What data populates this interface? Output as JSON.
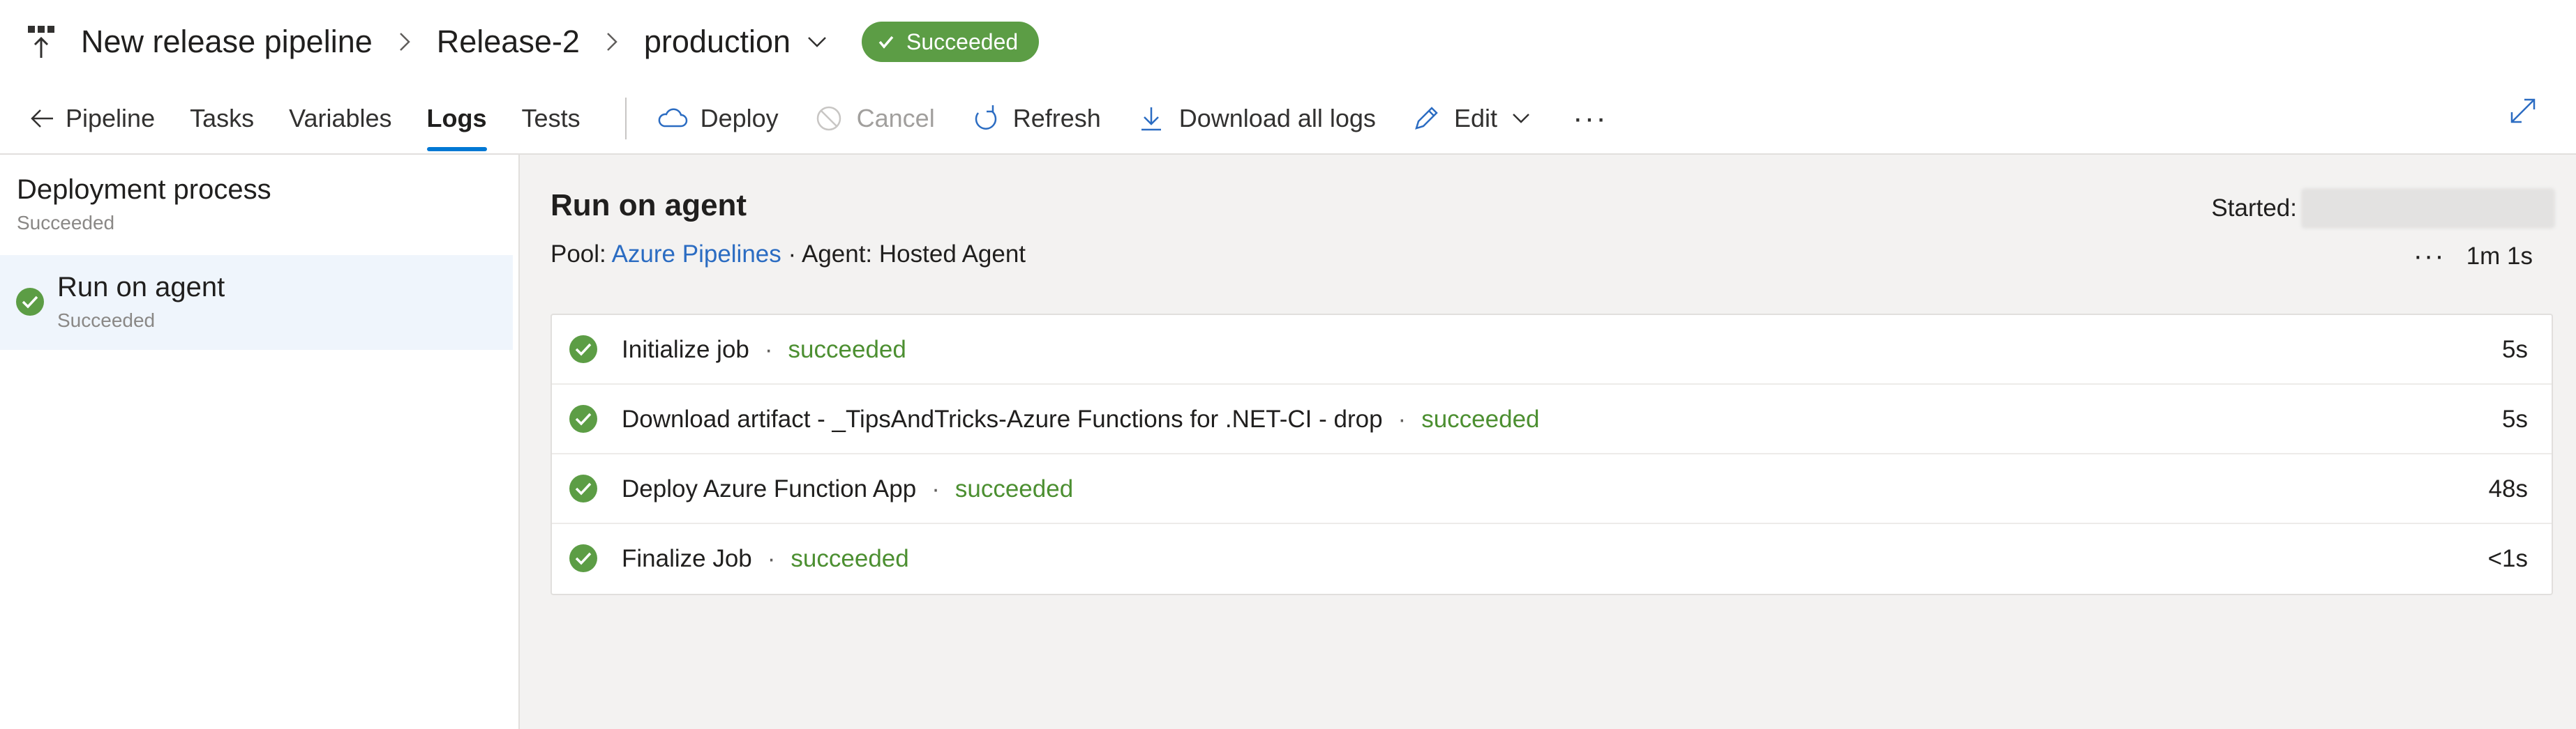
{
  "header": {
    "breadcrumbs": [
      "New release pipeline",
      "Release-2",
      "production"
    ],
    "status": "Succeeded",
    "status_color": "#5c9d45"
  },
  "toolbar": {
    "tabs": [
      "Pipeline",
      "Tasks",
      "Variables",
      "Logs",
      "Tests"
    ],
    "active_tab": "Logs",
    "actions": {
      "deploy": "Deploy",
      "cancel": "Cancel",
      "refresh": "Refresh",
      "download": "Download all logs",
      "edit": "Edit"
    }
  },
  "left_panel": {
    "title": "Deployment process",
    "status": "Succeeded",
    "items": [
      {
        "name": "Run on agent",
        "status": "Succeeded"
      }
    ]
  },
  "main": {
    "title": "Run on agent",
    "pool_label": "Pool:",
    "pool_link": "Azure Pipelines",
    "separator": "·",
    "agent": "Agent: Hosted Agent",
    "started_label": "Started:",
    "duration": "1m 1s",
    "steps": [
      {
        "name": "Initialize job",
        "status": "succeeded",
        "duration": "5s"
      },
      {
        "name": "Download artifact - _TipsAndTricks-Azure Functions for .NET-CI - drop",
        "status": "succeeded",
        "duration": "5s"
      },
      {
        "name": "Deploy Azure Function App",
        "status": "succeeded",
        "duration": "48s"
      },
      {
        "name": "Finalize Job",
        "status": "succeeded",
        "duration": "<1s"
      }
    ]
  },
  "colors": {
    "accent": "#0078d4",
    "success": "#5c9d45",
    "link": "#2b6cc2"
  }
}
